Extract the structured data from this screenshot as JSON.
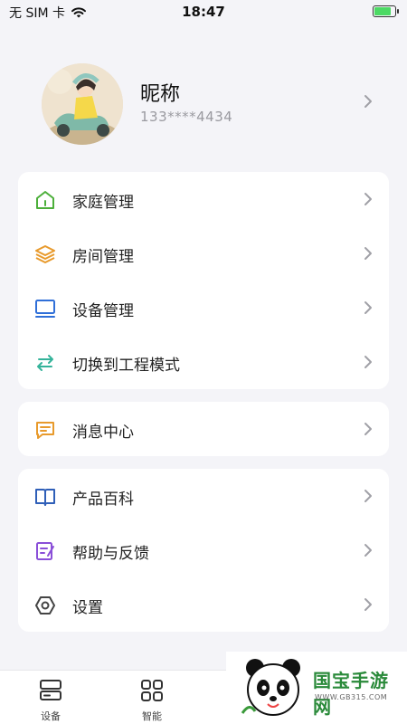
{
  "status_bar": {
    "carrier": "无 SIM 卡",
    "time": "18:47",
    "battery_level": 0.85
  },
  "profile": {
    "nickname": "昵称",
    "phone": "133****4434"
  },
  "menu_group_1": [
    {
      "label": "家庭管理",
      "icon": "home-icon",
      "color": "#4caf3a"
    },
    {
      "label": "房间管理",
      "icon": "layers-icon",
      "color": "#e89a2c"
    },
    {
      "label": "设备管理",
      "icon": "device-icon",
      "color": "#2f6fd8"
    },
    {
      "label": "切换到工程模式",
      "icon": "switch-icon",
      "color": "#34b39a"
    }
  ],
  "menu_group_2": [
    {
      "label": "消息中心",
      "icon": "message-icon",
      "color": "#e89a2c"
    }
  ],
  "menu_group_3": [
    {
      "label": "产品百科",
      "icon": "book-icon",
      "color": "#2f5fb8"
    },
    {
      "label": "帮助与反馈",
      "icon": "feedback-icon",
      "color": "#8a4fd8"
    },
    {
      "label": "设置",
      "icon": "settings-icon",
      "color": "#444444"
    }
  ],
  "tabbar": {
    "tabs": [
      {
        "label": "设备",
        "icon": "device-tab-icon"
      },
      {
        "label": "智能",
        "icon": "smart-grid-icon"
      }
    ]
  },
  "watermark": {
    "text": "国宝手游网",
    "url": "WWW.GB315.COM"
  }
}
